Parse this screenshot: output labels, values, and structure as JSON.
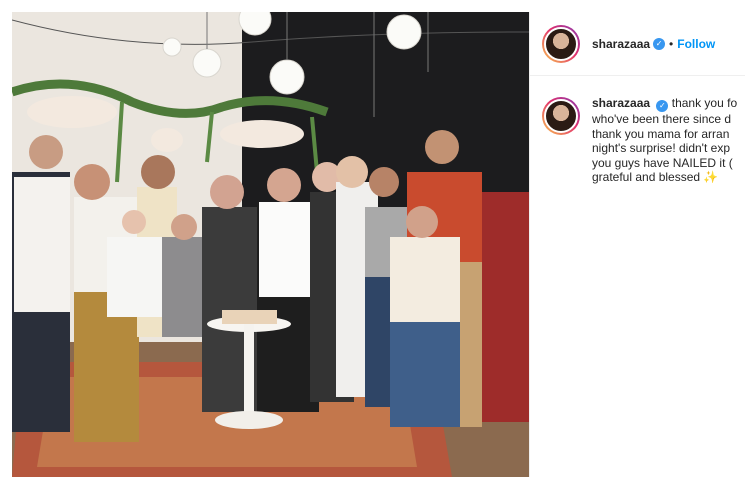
{
  "post": {
    "author": {
      "username": "sharazaaa",
      "verified_icon": "verified-badge-icon",
      "follow_label": "Follow",
      "separator": "•"
    },
    "caption": {
      "username": "sharazaaa",
      "lines": [
        "thank you fo",
        "who've been there since d",
        "thank you mama for arran",
        "night's surprise! didn't exp",
        "you guys have NAILED it (",
        "grateful and blessed"
      ],
      "emoji": "✨"
    },
    "colors": {
      "accent": "#0095f6",
      "verified": "#3897f0",
      "text": "#262626"
    }
  }
}
